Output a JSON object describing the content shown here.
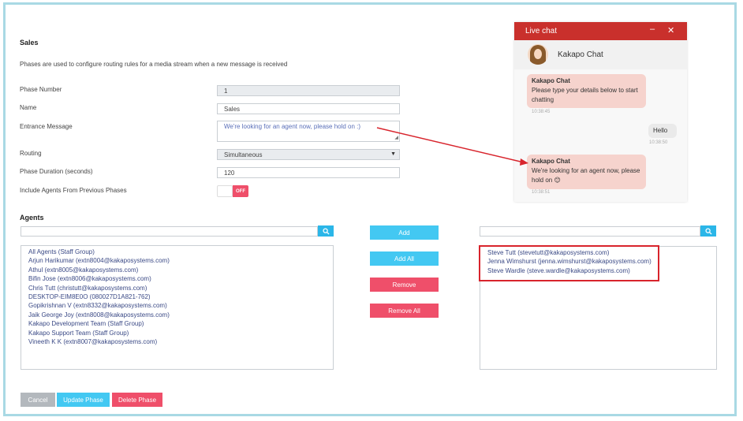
{
  "form": {
    "title": "Sales",
    "description": "Phases are used to configure routing rules for a media stream when a new message is received",
    "phase_number_label": "Phase Number",
    "phase_number_value": "1",
    "name_label": "Name",
    "name_value": "Sales",
    "entrance_label": "Entrance Message",
    "entrance_value": "We're looking for an agent now, please hold on :)",
    "routing_label": "Routing",
    "routing_value": "Simultaneous",
    "duration_label": "Phase Duration (seconds)",
    "duration_value": "120",
    "include_label": "Include Agents From Previous Phases",
    "toggle_state": "OFF"
  },
  "agents": {
    "title": "Agents",
    "available": [
      "All Agents (Staff Group)",
      "Arjun Harikumar (extn8004@kakaposystems.com)",
      "Athul (extn8005@kakaposystems.com)",
      "Bifin Jose (extn8006@kakaposystems.com)",
      "Chris Tutt (christutt@kakaposystems.com)",
      "DESKTOP-EIM8E0O (080027D1A821-762)",
      "Gopikrishnan V (extn8332@kakaposystems.com)",
      "Jaik George Joy (extn8008@kakaposystems.com)",
      "Kakapo Development Team (Staff Group)",
      "Kakapo Support Team (Staff Group)",
      "Vineeth K K (extn8007@kakaposystems.com)"
    ],
    "selected": [
      "Steve Tutt (stevetutt@kakaposystems.com)",
      "Jenna Wimshurst (jenna.wimshurst@kakaposystems.com)",
      "Steve Wardle (steve.wardle@kakaposystems.com)"
    ],
    "add": "Add",
    "add_all": "Add All",
    "remove": "Remove",
    "remove_all": "Remove All"
  },
  "footer": {
    "cancel": "Cancel",
    "update": "Update Phase",
    "delete": "Delete Phase"
  },
  "chat": {
    "header_title": "Live chat",
    "minimize": "–",
    "close": "✕",
    "agent_name": "Kakapo Chat",
    "messages": [
      {
        "from": "Kakapo Chat",
        "text": "Please type your details below to start chatting",
        "time": "10:38:45"
      },
      {
        "from": "",
        "text": "Hello",
        "time": "10:38:50"
      },
      {
        "from": "Kakapo Chat",
        "text": "We're looking for an agent now, please hold on 😊",
        "time": "10:38:51"
      }
    ]
  },
  "colors": {
    "accent_blue": "#43c8f2",
    "danger_red": "#ef4f6a",
    "chat_header": "#c9302c",
    "annotation_red": "#d8242c"
  },
  "icons": {
    "search": "search-icon",
    "select": "chevron-down-icon",
    "avatar": "agent-avatar"
  }
}
